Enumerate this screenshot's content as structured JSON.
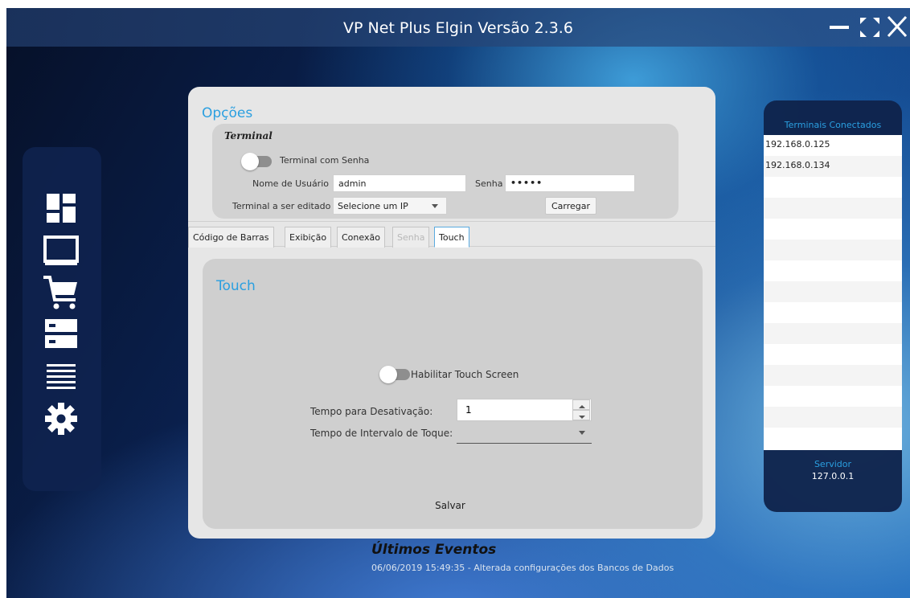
{
  "window": {
    "title": "VP Net Plus Elgin Versão 2.3.6",
    "controls": [
      "minimize-icon",
      "maximize-icon",
      "close-icon"
    ]
  },
  "sidebar": {
    "icons": [
      "dashboard-icon",
      "monitor-icon",
      "cart-icon",
      "server-icon",
      "list-icon",
      "gear-icon"
    ]
  },
  "options": {
    "title": "Opções",
    "terminal_section": {
      "label": "Terminal",
      "password_toggle_label": "Terminal com Senha",
      "password_toggle_on": false,
      "username_label": "Nome de Usuário",
      "username_value": "admin",
      "password_label": "Senha",
      "password_value": "•••••",
      "edit_terminal_label": "Terminal a ser editado",
      "edit_terminal_value": "Selecione um IP",
      "load_button": "Carregar"
    },
    "tabs": [
      {
        "label": "Código de Barras",
        "state": "normal"
      },
      {
        "label": "Exibição",
        "state": "normal"
      },
      {
        "label": "Conexão",
        "state": "normal"
      },
      {
        "label": "Senha",
        "state": "disabled"
      },
      {
        "label": "Touch",
        "state": "active"
      }
    ]
  },
  "touch": {
    "title": "Touch",
    "enable_label": "Habilitar Touch Screen",
    "enable_on": false,
    "deactivation_label": "Tempo para Desativação:",
    "deactivation_value": "1",
    "interval_label": "Tempo de Intervalo de Toque:",
    "interval_value": "",
    "save_button": "Salvar"
  },
  "connected_terminals": {
    "title": "Terminais Conectados",
    "items": [
      "192.168.0.125",
      "192.168.0.134"
    ],
    "server_label": "Servidor",
    "server_ip": "127.0.0.1"
  },
  "events": {
    "title": "Últimos Eventos",
    "latest": "06/06/2019 15:49:35 - Alterada configurações dos Bancos de Dados"
  },
  "colors": {
    "accent": "#2a9fe0",
    "panel": "#e6e6e6",
    "sidebar": "#0f2350"
  }
}
